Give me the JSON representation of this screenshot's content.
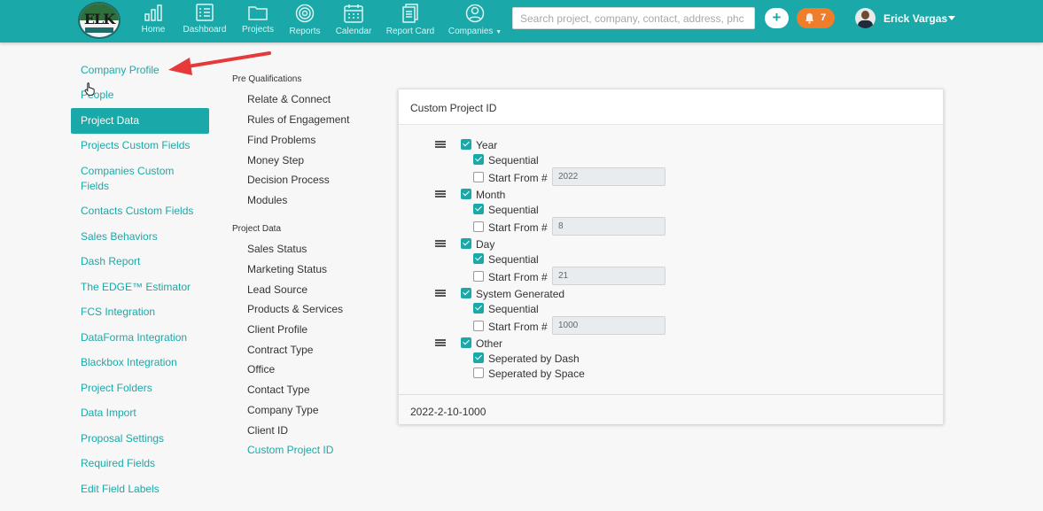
{
  "header": {
    "logo_text": "ELK",
    "nav": [
      {
        "label": "Home",
        "icon": "bar-chart-icon"
      },
      {
        "label": "Dashboard",
        "icon": "checklist-icon"
      },
      {
        "label": "Projects",
        "icon": "folder-icon"
      },
      {
        "label": "Reports",
        "icon": "target-icon"
      },
      {
        "label": "Calendar",
        "icon": "calendar-icon"
      },
      {
        "label": "Report Card",
        "icon": "documents-icon"
      },
      {
        "label": "Companies",
        "icon": "user-circle-icon"
      }
    ],
    "search_placeholder": "Search project, company, contact, address, phc",
    "plus_label": "+",
    "notification_count": "7",
    "user_name": "Erick Vargas",
    "colors": {
      "brand": "#1aa9a8",
      "notification": "#ef7d2c"
    }
  },
  "left_nav": {
    "items": [
      {
        "label": "Company Profile"
      },
      {
        "label": "People"
      },
      {
        "label": "Project Data",
        "active": true
      },
      {
        "label": "Projects Custom Fields"
      },
      {
        "label": "Companies Custom Fields"
      },
      {
        "label": "Contacts Custom Fields"
      },
      {
        "label": "Sales Behaviors"
      },
      {
        "label": "Dash Report"
      },
      {
        "label": "The EDGE™ Estimator"
      },
      {
        "label": "FCS Integration"
      },
      {
        "label": "DataForma Integration"
      },
      {
        "label": "Blackbox Integration"
      },
      {
        "label": "Project Folders"
      },
      {
        "label": "Data Import"
      },
      {
        "label": "Proposal Settings"
      },
      {
        "label": "Required Fields"
      },
      {
        "label": "Edit Field Labels"
      }
    ]
  },
  "sub_nav": {
    "pre_qualifications": {
      "heading": "Pre Qualifications",
      "items": [
        "Relate & Connect",
        "Rules of Engagement",
        "Find Problems",
        "Money Step",
        "Decision Process",
        "Modules"
      ]
    },
    "project_data": {
      "heading": "Project Data",
      "items": [
        "Sales Status",
        "Marketing Status",
        "Lead Source",
        "Products & Services",
        "Client Profile",
        "Contract Type",
        "Office",
        "Contact Type",
        "Company Type",
        "Client ID",
        "Custom Project ID"
      ],
      "active": "Custom Project ID"
    }
  },
  "card": {
    "title": "Custom Project ID",
    "groups": [
      {
        "label": "Year",
        "checked": true,
        "sequential_label": "Sequential",
        "sequential": true,
        "start_from_label": "Start From #",
        "start_from_checked": false,
        "start_from_value": "2022"
      },
      {
        "label": "Month",
        "checked": true,
        "sequential_label": "Sequential",
        "sequential": true,
        "start_from_label": "Start From #",
        "start_from_checked": false,
        "start_from_value": "8"
      },
      {
        "label": "Day",
        "checked": true,
        "sequential_label": "Sequential",
        "sequential": true,
        "start_from_label": "Start From #",
        "start_from_checked": false,
        "start_from_value": "21"
      },
      {
        "label": "System Generated",
        "checked": true,
        "sequential_label": "Sequential",
        "sequential": true,
        "start_from_label": "Start From #",
        "start_from_checked": false,
        "start_from_value": "1000"
      }
    ],
    "other": {
      "label": "Other",
      "checked": true,
      "options": [
        {
          "label": "Seperated by Dash",
          "checked": true
        },
        {
          "label": "Seperated by Space",
          "checked": false
        }
      ]
    },
    "result": "2022-2-10-1000"
  }
}
